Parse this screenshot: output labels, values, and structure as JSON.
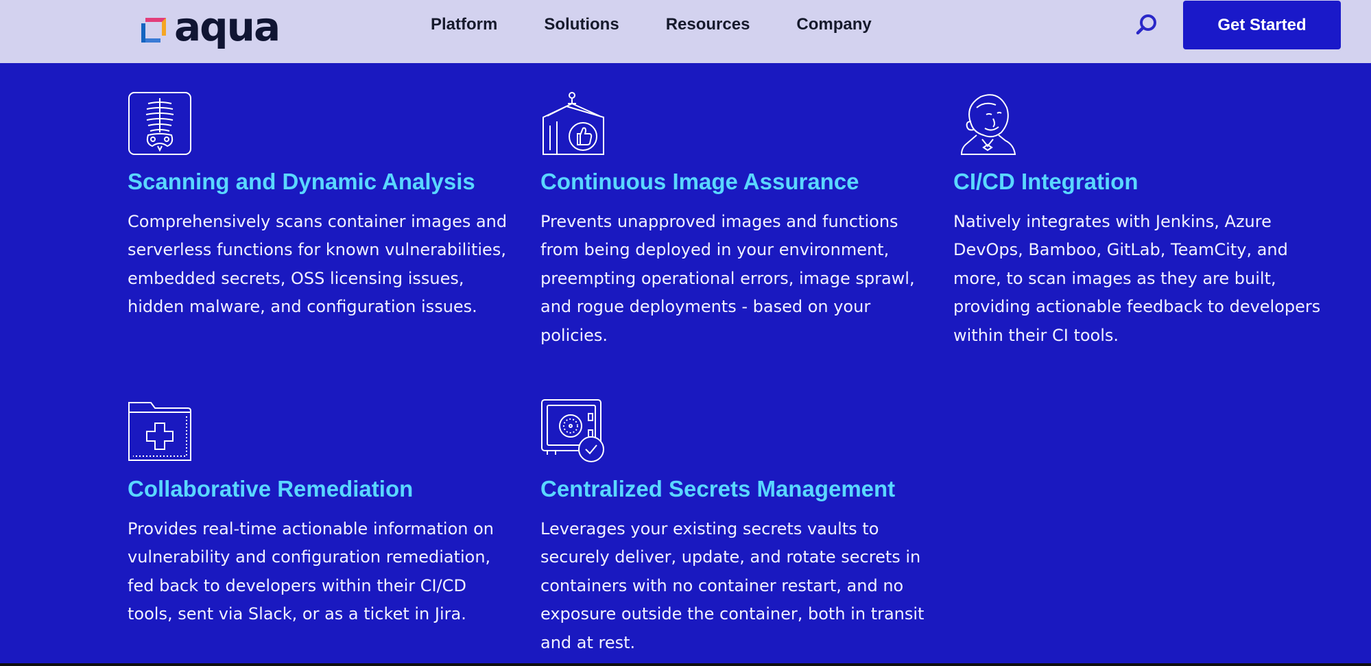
{
  "brand": {
    "logo_text": "aqua",
    "colors": {
      "header_bg": "#d3d2ef",
      "page_bg": "#1a19c0",
      "accent": "#5ad7ff",
      "cta_bg": "#1a19c9"
    }
  },
  "nav": {
    "items": [
      {
        "label": "Platform"
      },
      {
        "label": "Solutions"
      },
      {
        "label": "Resources"
      },
      {
        "label": "Company"
      }
    ],
    "search_icon": "search-icon",
    "cta_label": "Get Started"
  },
  "features": [
    {
      "icon": "xray-skeleton-icon",
      "title": "Scanning and Dynamic Analysis",
      "description": "Comprehensively scans container images and serverless functions for known vulnerabilities, embedded secrets, OSS licensing issues, hidden malware, and configuration issues."
    },
    {
      "icon": "container-thumbs-up-icon",
      "title": "Continuous Image Assurance",
      "description": "Prevents unapproved images and functions from being deployed in your environment, preempting operational errors, image sprawl, and rogue deployments - based on your policies."
    },
    {
      "icon": "jenkins-butler-icon",
      "title": "CI/CD Integration",
      "description": "Natively integrates with Jenkins, Azure DevOps, Bamboo, GitLab, TeamCity, and more, to scan images as they are built, providing actionable feedback to developers within their CI tools."
    },
    {
      "icon": "folder-plus-icon",
      "title": "Collaborative Remediation",
      "description": "Provides real-time actionable information on vulnerability and configuration remediation, fed back to developers within their CI/CD tools, sent via Slack, or as a ticket in Jira."
    },
    {
      "icon": "vault-check-icon",
      "title": "Centralized Secrets Management",
      "description": "Leverages your existing secrets vaults to securely deliver, update, and rotate secrets in containers with no container restart, and no exposure outside the container, both in transit and at rest."
    }
  ]
}
